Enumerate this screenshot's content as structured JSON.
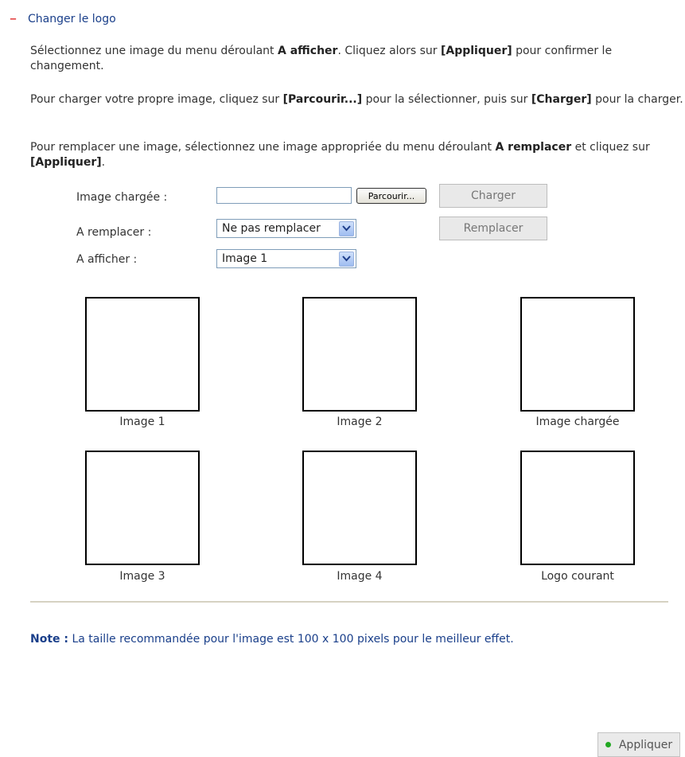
{
  "section": {
    "title": "Changer le logo",
    "collapse_icon": "minus-icon"
  },
  "instructions": {
    "p1": {
      "t1": "Sélectionnez une image du menu déroulant ",
      "b1": "A afficher",
      "t2": ". Cliquez alors sur ",
      "b2": "[Appliquer]",
      "t3": " pour confirmer le changement."
    },
    "p2": {
      "t1": "Pour charger votre propre image, cliquez sur ",
      "b1": "[Parcourir...]",
      "t2": " pour la sélectionner, puis sur ",
      "b2": "[Charger]",
      "t3": " pour la charger."
    },
    "p3": {
      "t1": "Pour remplacer une image, sélectionnez une image appropriée du menu déroulant ",
      "b1": "A remplacer",
      "t2": " et cliquez sur ",
      "b2": "[Appliquer]",
      "t3": "."
    }
  },
  "form": {
    "uploaded_label": "Image chargée :",
    "file_value": "",
    "browse_label": "Parcourir...",
    "charger_label": "Charger",
    "replace_label": "A remplacer :",
    "replace_value": "Ne pas remplacer",
    "remplacer_label": "Remplacer",
    "display_label": "A afficher :",
    "display_value": "Image 1"
  },
  "images": [
    {
      "caption": "Image 1"
    },
    {
      "caption": "Image 2"
    },
    {
      "caption": "Image chargée"
    },
    {
      "caption": "Image 3"
    },
    {
      "caption": "Image 4"
    },
    {
      "caption": "Logo courant"
    }
  ],
  "note": {
    "label": "Note :",
    "text": " La taille recommandée pour l'image est 100 x 100 pixels pour le meilleur effet."
  },
  "apply": {
    "label": "Appliquer"
  },
  "colors": {
    "accent": "#1a3f8a",
    "collapse": "#dd1111",
    "apply_dot": "#22a822"
  }
}
